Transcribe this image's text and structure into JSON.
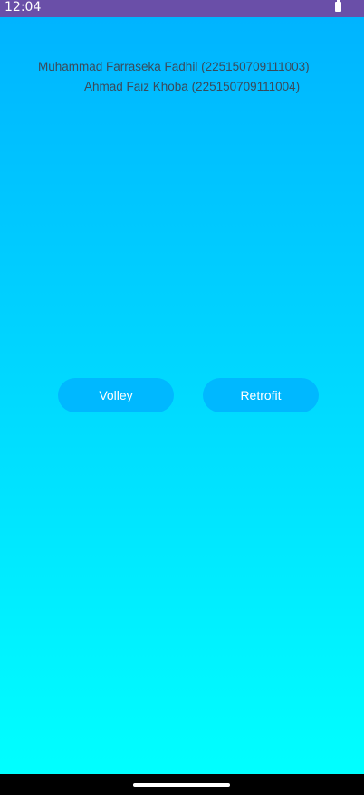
{
  "status_bar": {
    "time": "12:04",
    "battery_icon": "battery-icon",
    "color": "#6a4fa8"
  },
  "authors": [
    "Muhammad Farraseka Fadhil (225150709111003)",
    "Ahmad Faiz Khoba (225150709111004)"
  ],
  "buttons": {
    "volley_label": "Volley",
    "retrofit_label": "Retrofit",
    "color": "#00b8ff"
  },
  "background": {
    "gradient_top": "#00b4ff",
    "gradient_bottom": "#00ffff"
  },
  "nav_bar": {
    "home_handle_icon": "home-handle"
  }
}
